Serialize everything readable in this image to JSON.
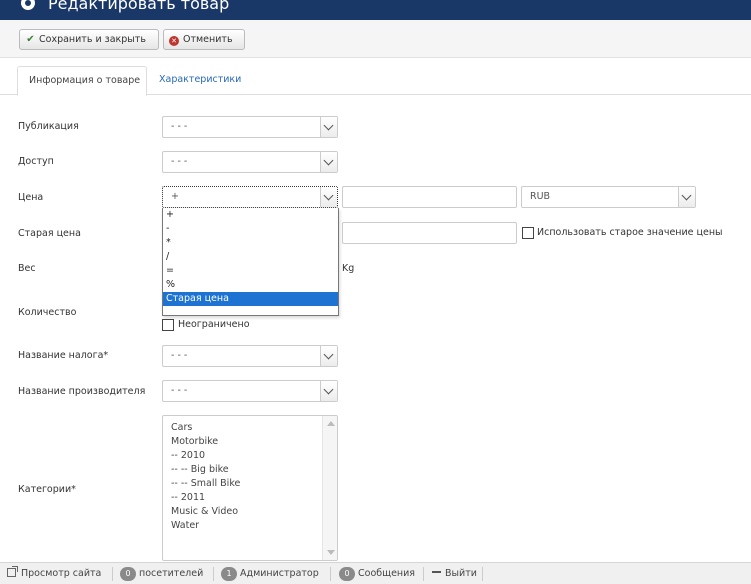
{
  "header": {
    "title": "Редактировать товар"
  },
  "toolbar": {
    "save_close": "Сохранить и закрыть",
    "cancel": "Отменить"
  },
  "tabs": [
    {
      "label": "Информация о товаре",
      "active": true
    },
    {
      "label": "Характеристики",
      "active": false
    }
  ],
  "form": {
    "publish": {
      "label": "Публикация",
      "value": "- - -"
    },
    "access": {
      "label": "Доступ",
      "value": "- - -"
    },
    "price": {
      "label": "Цена",
      "modifier": "+",
      "value": "",
      "currency": "RUB",
      "dropdown_options": [
        "+",
        "-",
        "*",
        "/",
        "=",
        "%",
        "Старая цена"
      ],
      "dropdown_selected": "Старая цена"
    },
    "old_price": {
      "label": "Старая цена",
      "value": "",
      "use_old_label": "Использовать старое значение цены",
      "use_old_checked": false
    },
    "weight": {
      "label": "Вес",
      "unit": "Kg"
    },
    "quantity": {
      "label": "Количество",
      "unlimited_label": "Неограничено",
      "unlimited_checked": false
    },
    "tax": {
      "label": "Название налога*",
      "value": "- - -"
    },
    "manufacturer": {
      "label": "Название производителя",
      "value": "- - -"
    },
    "categories": {
      "label": "Категории*",
      "items": [
        "Cars",
        "Motorbike",
        "-- 2010",
        "-- -- Big bike",
        "-- -- Small Bike",
        "-- 2011",
        "Music & Video",
        "Water"
      ]
    }
  },
  "statusbar": {
    "view_site": "Просмотр сайта",
    "visitors_count": "0",
    "visitors_label": "посетителей",
    "admins_count": "1",
    "admins_label": "Администратор",
    "messages_count": "0",
    "messages_label": "Сообщения",
    "logout": "Выйти"
  },
  "colors": {
    "header_bg": "#1a3867",
    "link": "#2a69b8",
    "selected": "#1e73d2"
  }
}
